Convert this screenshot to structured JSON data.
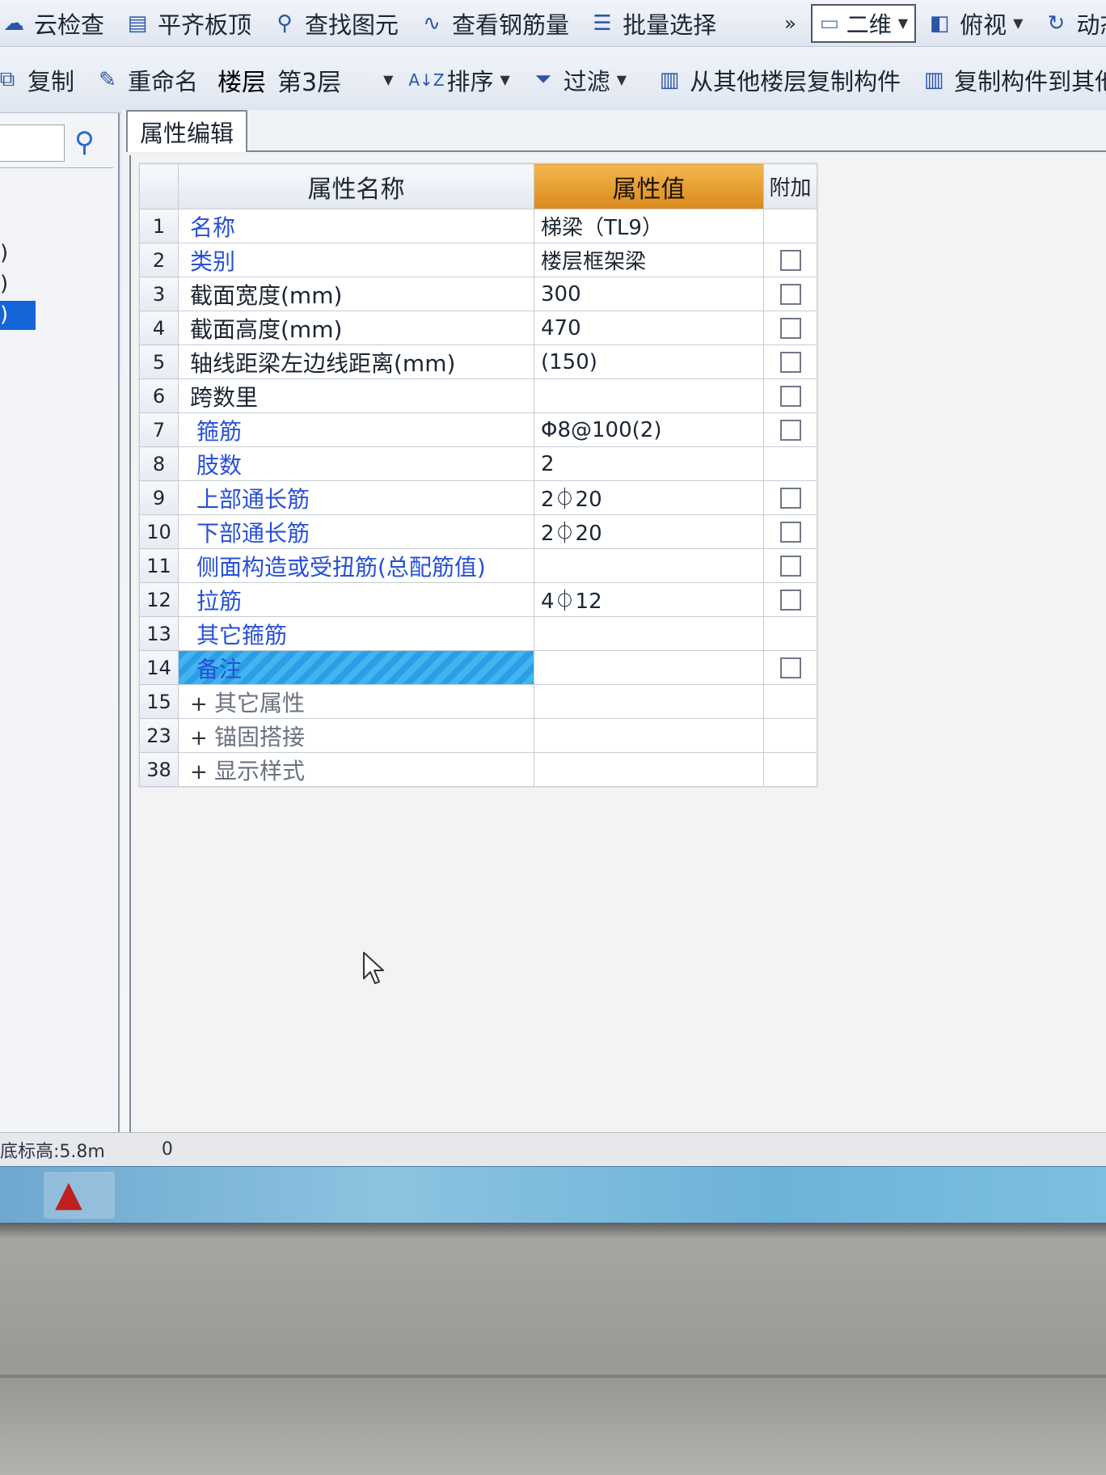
{
  "toolbar1": {
    "cloud_check": "云检查",
    "align_top": "平齐板顶",
    "find_element": "查找图元",
    "view_rebar": "查看钢筋量",
    "batch_select": "批量选择",
    "more": "»",
    "view_mode": "二维",
    "view_angle": "俯视",
    "dynamic": "动态"
  },
  "toolbar2": {
    "copy": "复制",
    "rename": "重命名",
    "floor_label": "楼层",
    "floor_value": "第3层",
    "sort": "排序",
    "filter": "过滤",
    "copy_from_floor": "从其他楼层复制构件",
    "copy_to_floor": "复制构件到其他楼层"
  },
  "left_panel": {
    "tree_fragments": [
      ")",
      ")",
      ")"
    ]
  },
  "property_panel": {
    "tab_label": "属性编辑",
    "headers": {
      "name": "属性名称",
      "value": "属性值",
      "extra": "附加"
    },
    "rows": [
      {
        "num": "1",
        "name": "名称",
        "value": "梯梁（TL9）",
        "checkbox": false
      },
      {
        "num": "2",
        "name": "类别",
        "value": "楼层框架梁",
        "checkbox": true
      },
      {
        "num": "3",
        "name": "截面宽度(mm)",
        "value": "300",
        "checkbox": true
      },
      {
        "num": "4",
        "name": "截面高度(mm)",
        "value": "470",
        "checkbox": true
      },
      {
        "num": "5",
        "name": "轴线距梁左边线距离(mm)",
        "value": "(150)",
        "checkbox": true
      },
      {
        "num": "6",
        "name": "跨数里",
        "value": "",
        "checkbox": true
      },
      {
        "num": "7",
        "name": "箍筋",
        "value": "Φ8@100(2)",
        "checkbox": true
      },
      {
        "num": "8",
        "name": "肢数",
        "value": "2",
        "checkbox": false
      },
      {
        "num": "9",
        "name": "上部通长筋",
        "value": "2⏀20",
        "checkbox": true
      },
      {
        "num": "10",
        "name": "下部通长筋",
        "value": "2⏀20",
        "checkbox": true
      },
      {
        "num": "11",
        "name": "侧面构造或受扭筋(总配筋值)",
        "value": "",
        "checkbox": true
      },
      {
        "num": "12",
        "name": "拉筋",
        "value": "4⏀12",
        "checkbox": true
      },
      {
        "num": "13",
        "name": "其它箍筋",
        "value": "",
        "checkbox": false
      },
      {
        "num": "14",
        "name": "备注",
        "value": "",
        "checkbox": true
      },
      {
        "num": "15",
        "name": "其它属性",
        "value": "",
        "checkbox": false,
        "expander": "+"
      },
      {
        "num": "23",
        "name": "锚固搭接",
        "value": "",
        "checkbox": false,
        "expander": "+"
      },
      {
        "num": "38",
        "name": "显示样式",
        "value": "",
        "checkbox": false,
        "expander": "+"
      }
    ]
  },
  "status_bar": {
    "elevation": "底标高:5.8m",
    "count": "0"
  },
  "colors": {
    "value_header": "#e0961f",
    "selected_row": "#2a9fe6",
    "link_blue": "#2850d8"
  }
}
